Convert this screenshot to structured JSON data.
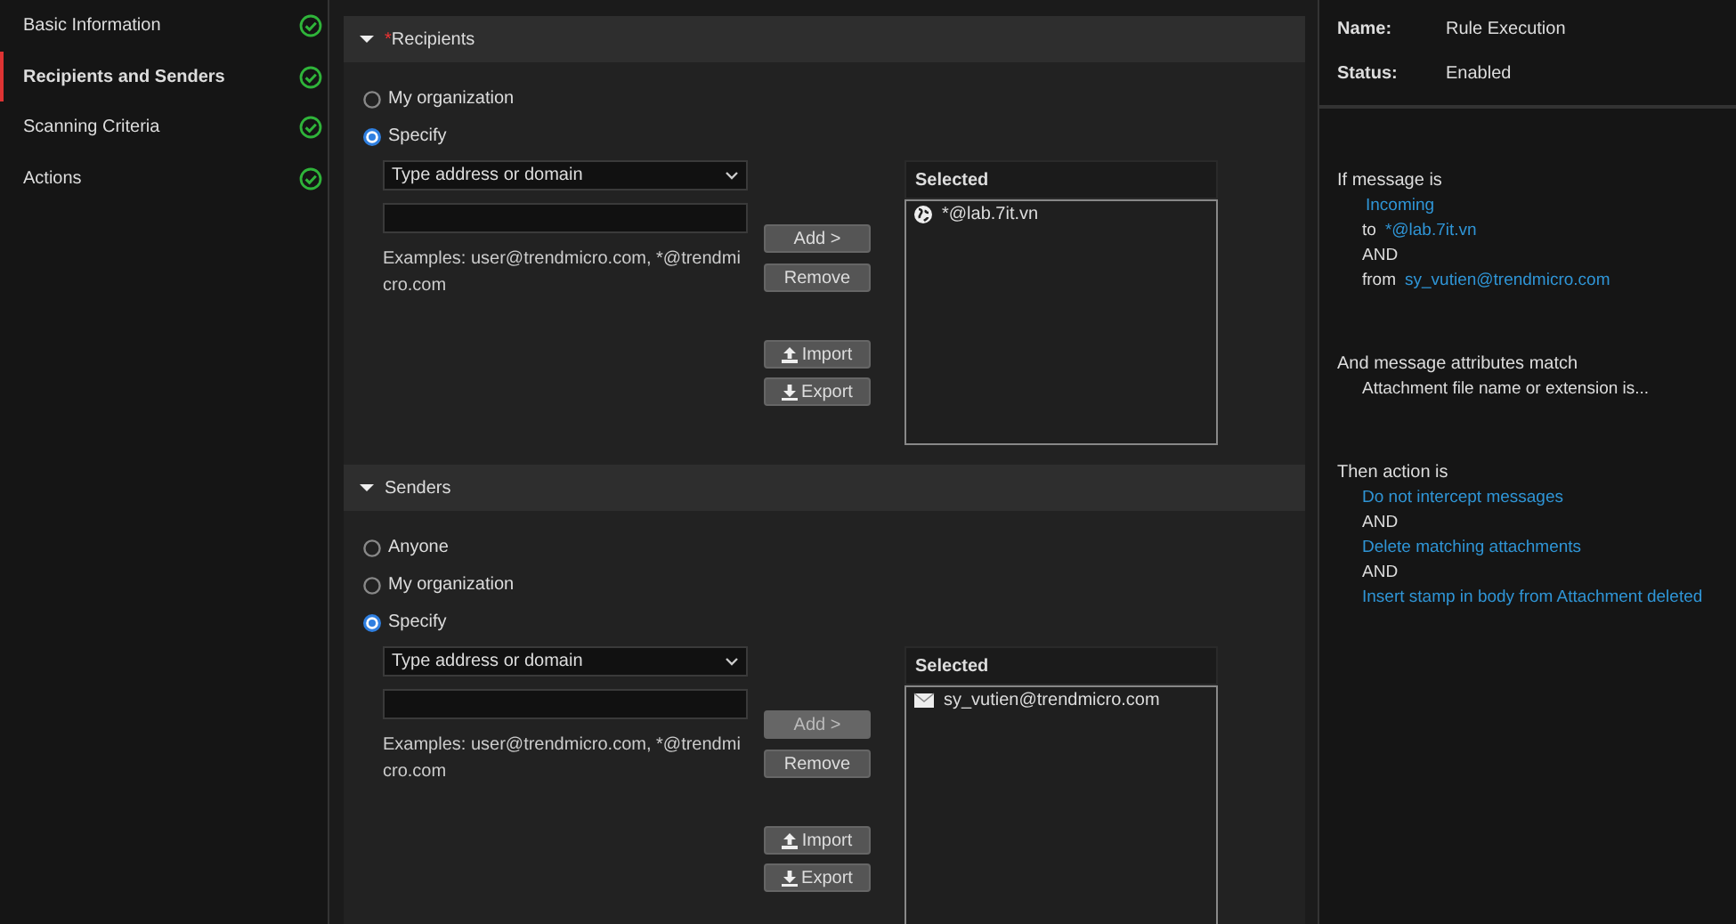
{
  "sidebar": {
    "items": [
      {
        "label": "Basic Information",
        "selected": false,
        "complete": true
      },
      {
        "label": "Recipients and Senders",
        "selected": true,
        "complete": true
      },
      {
        "label": "Scanning Criteria",
        "selected": false,
        "complete": true
      },
      {
        "label": "Actions",
        "selected": false,
        "complete": true
      }
    ]
  },
  "sections": [
    {
      "title": "Recipients",
      "required_mark": "*",
      "expanded": true,
      "options": [
        {
          "label": "My organization",
          "selected": false
        },
        {
          "label": "Specify",
          "selected": true
        }
      ],
      "select": {
        "value": "Type address or domain"
      },
      "examples": "Examples: user@trendmicro.com, *@trendmicro.com",
      "buttons": [
        {
          "label": "Add >",
          "kind": "plain",
          "disabled": false
        },
        {
          "label": "Remove",
          "kind": "plain",
          "disabled": false
        },
        {
          "label": "Import",
          "kind": "upload",
          "disabled": false
        },
        {
          "label": "Export",
          "kind": "download",
          "disabled": false
        }
      ],
      "selected_list": {
        "title": "Selected",
        "items": [
          {
            "text": "*@lab.7it.vn",
            "kind": "domain"
          }
        ]
      }
    },
    {
      "title": "Senders",
      "expanded": true,
      "options": [
        {
          "label": "Anyone",
          "selected": false
        },
        {
          "label": "My organization",
          "selected": false
        },
        {
          "label": "Specify",
          "selected": true
        }
      ],
      "select": {
        "value": "Type address or domain"
      },
      "examples": "Examples: user@trendmicro.com, *@trendmicro.com",
      "buttons": [
        {
          "label": "Add >",
          "kind": "plain",
          "disabled": true
        },
        {
          "label": "Remove",
          "kind": "plain",
          "disabled": false
        },
        {
          "label": "Import",
          "kind": "upload",
          "disabled": false
        },
        {
          "label": "Export",
          "kind": "download",
          "disabled": false
        }
      ],
      "selected_list": {
        "title": "Selected",
        "items": [
          {
            "text": "sy_vutien@trendmicro.com",
            "kind": "email"
          }
        ]
      }
    }
  ],
  "summary": {
    "fields": [
      {
        "label": "Name:",
        "value": "Rule Execution"
      },
      {
        "label": "Status:",
        "value": "Enabled"
      }
    ],
    "blocks": [
      {
        "heading": "If message is",
        "lines": [
          {
            "kind": "value",
            "text": "Incoming"
          },
          {
            "kind": "pair",
            "label": "to",
            "text": "*@lab.7it.vn"
          },
          {
            "kind": "plain",
            "text": "AND"
          },
          {
            "kind": "pair",
            "label": "from",
            "text": "sy_vutien@trendmicro.com"
          }
        ]
      },
      {
        "heading": "And message attributes match",
        "lines": [
          {
            "kind": "plain",
            "text": "Attachment file name or extension is..."
          }
        ]
      },
      {
        "heading": "Then action is",
        "lines": [
          {
            "kind": "value",
            "text": "Do not intercept messages"
          },
          {
            "kind": "plain",
            "text": "AND"
          },
          {
            "kind": "value",
            "text": "Delete matching attachments"
          },
          {
            "kind": "plain",
            "text": "AND"
          },
          {
            "kind": "value",
            "text": "Insert stamp in body from Attachment deleted"
          }
        ]
      }
    ]
  }
}
